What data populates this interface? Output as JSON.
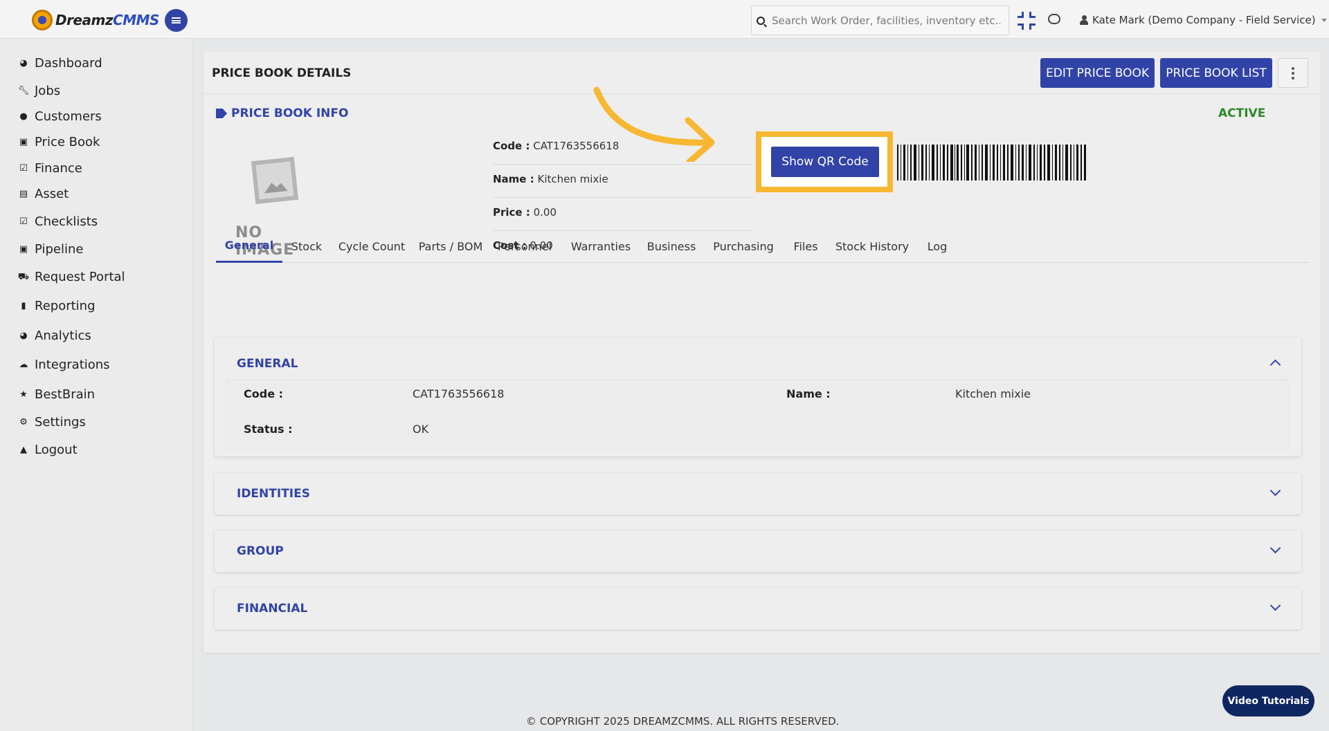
{
  "app": {
    "brand_part1": "Dreamz",
    "brand_part2": "CMMS"
  },
  "header": {
    "search_placeholder": "Search Work Order, facilities, inventory etc...",
    "user_label": "Kate Mark (Demo Company - Field Service)"
  },
  "sidebar": {
    "items": [
      {
        "label": "Dashboard",
        "icon": "tachometer-icon"
      },
      {
        "label": "Jobs",
        "icon": "wrench-icon"
      },
      {
        "label": "Customers",
        "icon": "users-icon"
      },
      {
        "label": "Price Book",
        "icon": "money-icon"
      },
      {
        "label": "Finance",
        "icon": "check-square-icon"
      },
      {
        "label": "Asset",
        "icon": "archive-icon"
      },
      {
        "label": "Checklists",
        "icon": "check-square-icon"
      },
      {
        "label": "Pipeline",
        "icon": "money-icon"
      },
      {
        "label": "Request Portal",
        "icon": "cart-icon"
      },
      {
        "label": "Reporting",
        "icon": "file-icon"
      },
      {
        "label": "Analytics",
        "icon": "tachometer-icon"
      },
      {
        "label": "Integrations",
        "icon": "cloud-icon"
      },
      {
        "label": "BestBrain",
        "icon": "star-icon"
      },
      {
        "label": "Settings",
        "icon": "gear-icon"
      },
      {
        "label": "Logout",
        "icon": "user-icon"
      }
    ]
  },
  "page": {
    "title": "PRICE BOOK DETAILS",
    "edit_button": "EDIT PRICE BOOK",
    "list_button": "PRICE BOOK LIST",
    "info_title": "PRICE BOOK INFO",
    "status": "ACTIVE",
    "no_image": "NO IMAGE",
    "qr_button": "Show QR Code",
    "fields": [
      {
        "label": "Code :",
        "value": "CAT1763556618"
      },
      {
        "label": "Name :",
        "value": "Kitchen mixie"
      },
      {
        "label": "Price :",
        "value": "0.00"
      },
      {
        "label": "Cost :",
        "value": "0.00"
      }
    ],
    "tabs": [
      "General",
      "Stock",
      "Cycle Count",
      "Parts / BOM",
      "Personnel",
      "Warranties",
      "Business",
      "Purchasing",
      "Files",
      "Stock History",
      "Log"
    ],
    "active_tab": "General",
    "sections": {
      "general": {
        "title": "GENERAL",
        "code_label": "Code :",
        "code_value": "CAT1763556618",
        "name_label": "Name :",
        "name_value": "Kitchen mixie",
        "status_label": "Status :",
        "status_value": "OK"
      },
      "identities": {
        "title": "IDENTITIES"
      },
      "group": {
        "title": "GROUP"
      },
      "financial": {
        "title": "FINANCIAL"
      }
    }
  },
  "footer": {
    "copyright": "© COPYRIGHT 2025 DREAMZCMMS. ALL RIGHTS RESERVED."
  },
  "video_tutorials": "Video Tutorials",
  "colors": {
    "primary": "#3243a8",
    "active_green": "#2c8a2c",
    "highlight": "#f7b731",
    "video_button": "#0f2760"
  }
}
